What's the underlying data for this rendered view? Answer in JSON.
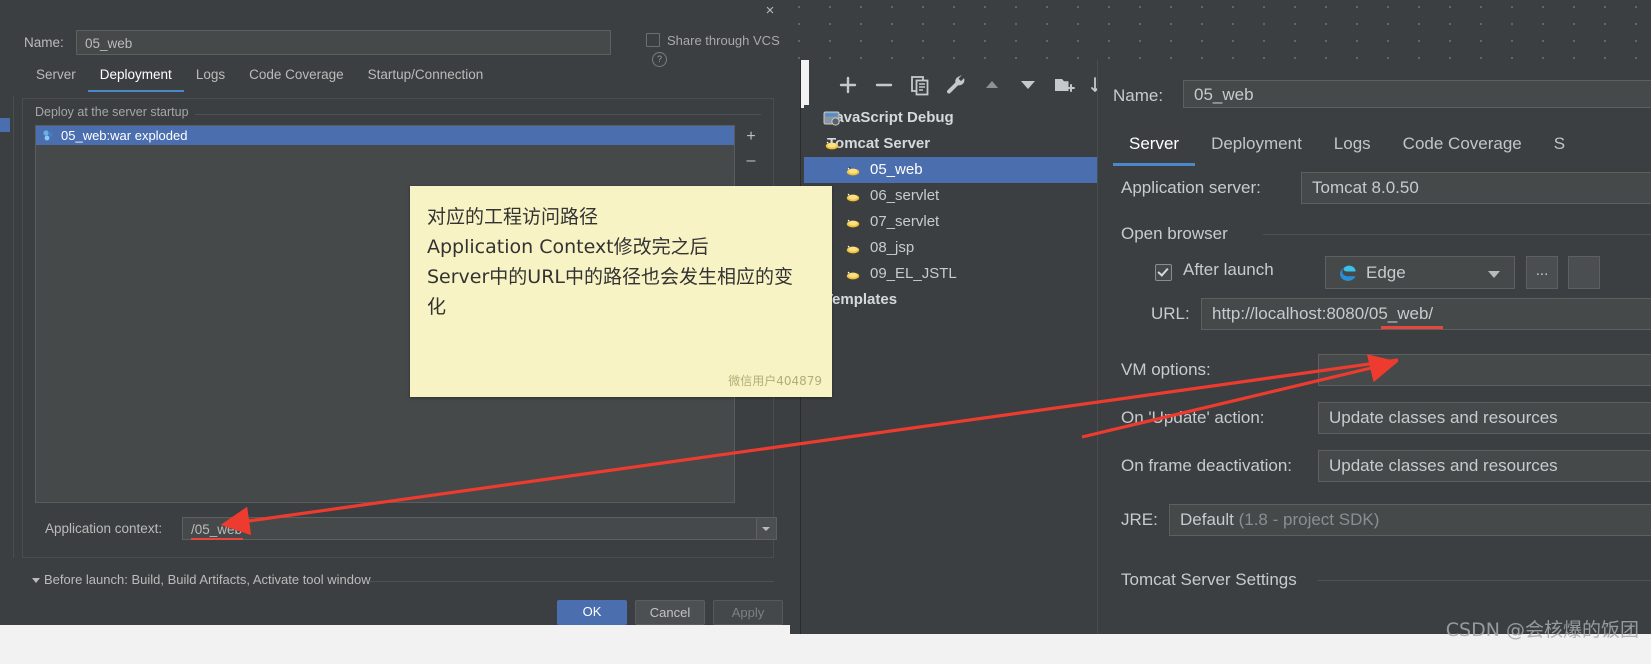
{
  "left_dialog": {
    "close_icon": "×",
    "name_label": "Name:",
    "name_value": "05_web",
    "share_vcs_label": "Share through VCS",
    "tabs": [
      {
        "label": "Server",
        "active": false
      },
      {
        "label": "Deployment",
        "active": true
      },
      {
        "label": "Logs",
        "active": false
      },
      {
        "label": "Code Coverage",
        "active": false
      },
      {
        "label": "Startup/Connection",
        "active": false
      }
    ],
    "deploy_group_title": "Deploy at the server startup",
    "deploy_rows": [
      {
        "label": "05_web:war exploded",
        "selected": true
      }
    ],
    "add_button": "+",
    "remove_button": "–",
    "app_context_label": "Application context:",
    "app_context_value": "/05_web",
    "before_launch_label": "Before launch: Build, Build Artifacts, Activate tool window",
    "buttons": {
      "ok": "OK",
      "cancel": "Cancel",
      "apply": "Apply"
    }
  },
  "note": {
    "line1": "对应的工程访问路径",
    "line2": "Application Context修改完之后",
    "line3": "Server中的URL中的路径也会发生相应的变",
    "line4": "化",
    "watermark": "微信用户404879"
  },
  "right_window": {
    "toolbar_icons": [
      "add-icon",
      "remove-icon",
      "copy-icon",
      "wrench-icon",
      "move-up-icon",
      "move-down-icon",
      "new-folder-icon",
      "sort-alpha-icon"
    ],
    "tree": [
      {
        "label": "JavaScript Debug",
        "icon": "javascript-debug-icon",
        "level": 0,
        "bold": true,
        "selected": false
      },
      {
        "label": "Tomcat Server",
        "icon": "tomcat-icon",
        "level": 0,
        "bold": true,
        "selected": false
      },
      {
        "label": "05_web",
        "icon": "tomcat-icon",
        "level": 1,
        "bold": false,
        "selected": true
      },
      {
        "label": "06_servlet",
        "icon": "tomcat-icon",
        "level": 1,
        "bold": false,
        "selected": false
      },
      {
        "label": "07_servlet",
        "icon": "tomcat-icon",
        "level": 1,
        "bold": false,
        "selected": false
      },
      {
        "label": "08_jsp",
        "icon": "tomcat-icon",
        "level": 1,
        "bold": false,
        "selected": false
      },
      {
        "label": "09_EL_JSTL",
        "icon": "tomcat-icon",
        "level": 1,
        "bold": false,
        "selected": false
      },
      {
        "label": "Templates",
        "icon": "none",
        "level": 0,
        "bold": true,
        "selected": false
      }
    ],
    "name_label": "Name:",
    "name_value": "05_web",
    "tabs": [
      {
        "label": "Server",
        "active": true
      },
      {
        "label": "Deployment",
        "active": false
      },
      {
        "label": "Logs",
        "active": false
      },
      {
        "label": "Code Coverage",
        "active": false
      },
      {
        "label": "S",
        "active": false
      }
    ],
    "form": {
      "application_server_label": "Application server:",
      "application_server_value": "Tomcat 8.0.50",
      "open_browser_title": "Open browser",
      "after_launch_label": "After launch",
      "after_launch_checked": true,
      "browser_value": "Edge",
      "browser_icon": "edge-icon",
      "ellipsis_label": "...",
      "url_label": "URL:",
      "url_value": "http://localhost:8080/05_web/",
      "vm_options_label": "VM options:",
      "vm_options_value": "",
      "on_update_label": "On 'Update' action:",
      "on_update_value": "Update classes and resources",
      "on_frame_deactivation_label": "On frame deactivation:",
      "on_frame_deactivation_value": "Update classes and resources",
      "jre_label": "JRE:",
      "jre_value": "Default",
      "jre_hint": " (1.8 - project SDK)",
      "tomcat_settings_title": "Tomcat Server Settings"
    }
  },
  "watermark": "CSDN @会核爆的饭团",
  "colors": {
    "accent": "#4b6eaf",
    "tab_underline": "#4a88c7",
    "arrow_red": "#ee3b2f",
    "note_bg": "#f7f3c4"
  }
}
